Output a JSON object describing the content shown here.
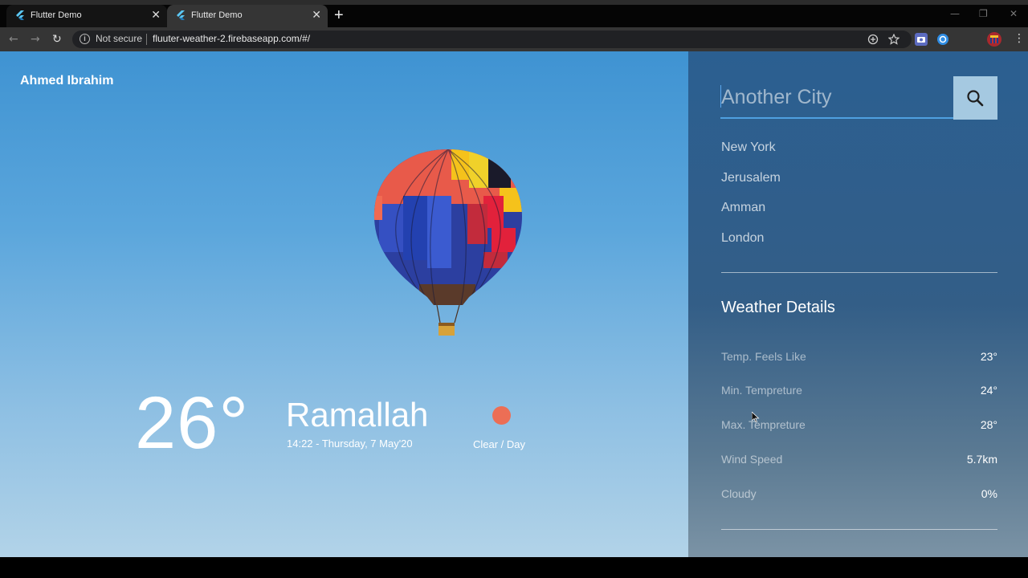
{
  "browser": {
    "tabs": [
      {
        "title": "Flutter Demo",
        "close": "✕"
      },
      {
        "title": "Flutter Demo",
        "close": "✕"
      }
    ],
    "new_tab": "+",
    "window_controls": {
      "minimize": "—",
      "restore": "❐",
      "close": "✕"
    },
    "nav": {
      "back": "←",
      "forward": "→",
      "reload": "↻"
    },
    "omnibox": {
      "security_label": "Not secure",
      "url": "fluuter-weather-2.firebaseapp.com/#/"
    },
    "toolbar_icons": [
      "add-circle-icon",
      "star-icon",
      "camera-extension-icon",
      "edge-extension-icon",
      "profile-avatar-icon",
      "menu-icon"
    ],
    "menu": "⋮"
  },
  "app": {
    "user_name": "Ahmed Ibrahim",
    "current": {
      "temperature": "26°",
      "city": "Ramallah",
      "datetime": "14:22 - Thursday, 7 May'20",
      "condition": "Clear / Day",
      "condition_color": "#ec6e55"
    },
    "search": {
      "placeholder": "Another City"
    },
    "cities": [
      "New York",
      "Jerusalem",
      "Amman",
      "London"
    ],
    "details": {
      "title": "Weather Details",
      "rows": [
        {
          "label": "Temp. Feels Like",
          "value": "23°"
        },
        {
          "label": "Min. Tempreture",
          "value": "24°"
        },
        {
          "label": "Max. Tempreture",
          "value": "28°"
        },
        {
          "label": "Wind Speed",
          "value": "5.7km"
        },
        {
          "label": "Cloudy",
          "value": "0%"
        }
      ]
    },
    "colors": {
      "sky_top": "#3f93d2",
      "panel": "#2b5f91",
      "search_button": "#a5c9e1",
      "accent": "#4fa0e0"
    }
  }
}
